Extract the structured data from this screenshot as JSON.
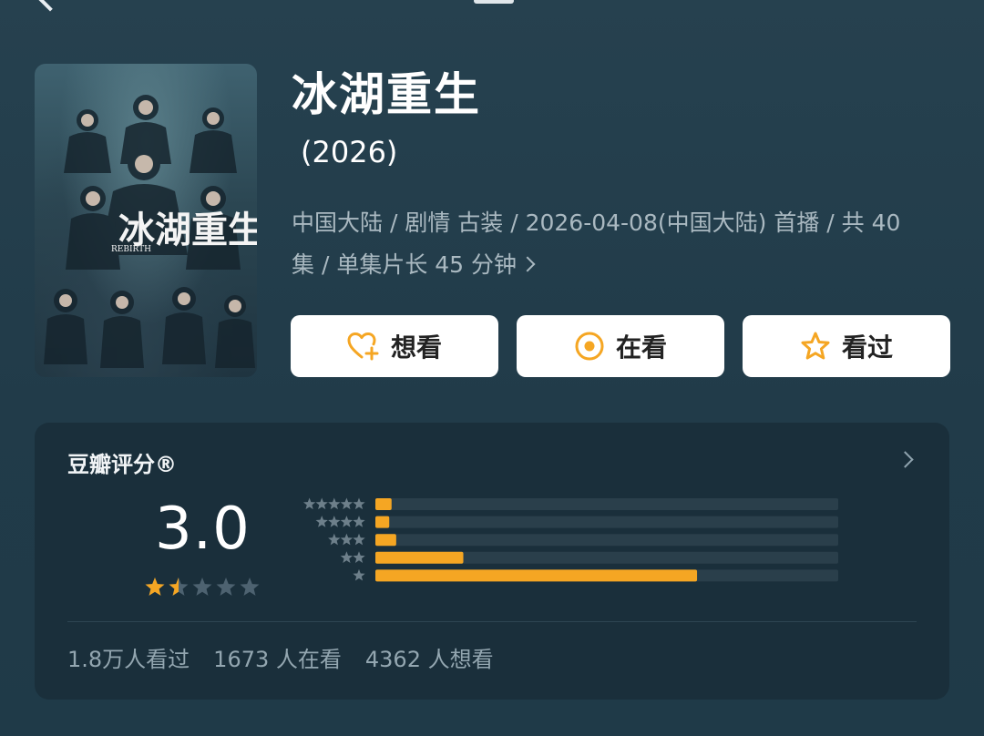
{
  "show": {
    "title": "冰湖重生",
    "year": "(2026)",
    "meta_line1": "中国大陆 / 剧情 古装 / 2026-04-08(中国大陆) 首播 / 共 40",
    "meta_line2": "集 / 单集片长 45 分钟",
    "poster_text": "冰湖重生",
    "poster_subtitle": "REBIRTH"
  },
  "actions": {
    "want": "想看",
    "doing": "在看",
    "done": "看过"
  },
  "rating": {
    "title": "豆瓣评分®",
    "score": "3.0",
    "stars_filled": 1.5,
    "stars_total": 5,
    "distribution_fraction": [
      0.035,
      0.03,
      0.045,
      0.19,
      0.695
    ]
  },
  "stats": {
    "watched": "1.8万人看过",
    "watching": "1673 人在看",
    "want": "4362 人想看"
  },
  "colors": {
    "accent": "#f5a623",
    "bar_track": "#2a3f4b",
    "background": "#223d4c",
    "card": "#1a2f3b"
  },
  "icons": {
    "want": "heart-plus-icon",
    "doing": "target-circle-icon",
    "done": "star-outline-icon"
  }
}
